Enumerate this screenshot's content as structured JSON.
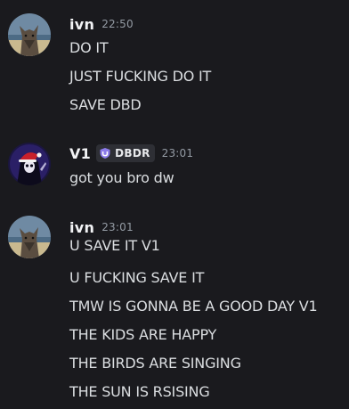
{
  "messages": [
    {
      "author": "ivn",
      "time": "22:50",
      "avatar": "wolf-beach-avatar",
      "lines": [
        "DO IT",
        "JUST FUCKING DO IT",
        "SAVE DBD"
      ]
    },
    {
      "author": "V1",
      "time": "23:01",
      "avatar": "reaper-santa-hat-avatar",
      "tag": {
        "icon": "shield-icon",
        "label": "DBDR",
        "color": "#8c7bea"
      },
      "lines": [
        "got you bro dw"
      ]
    },
    {
      "author": "ivn",
      "time": "23:01",
      "avatar": "wolf-beach-avatar",
      "lines": [
        "U SAVE IT V1",
        "U FUCKING SAVE IT",
        "TMW IS GONNA BE A GOOD DAY V1",
        "THE KIDS ARE HAPPY",
        "THE BIRDS ARE SINGING",
        "THE SUN IS RSISING"
      ]
    }
  ],
  "colors": {
    "background": "#1a1a1e",
    "username": "#f2f3f5",
    "text": "#dbdee1",
    "timestamp": "#949ba4"
  }
}
